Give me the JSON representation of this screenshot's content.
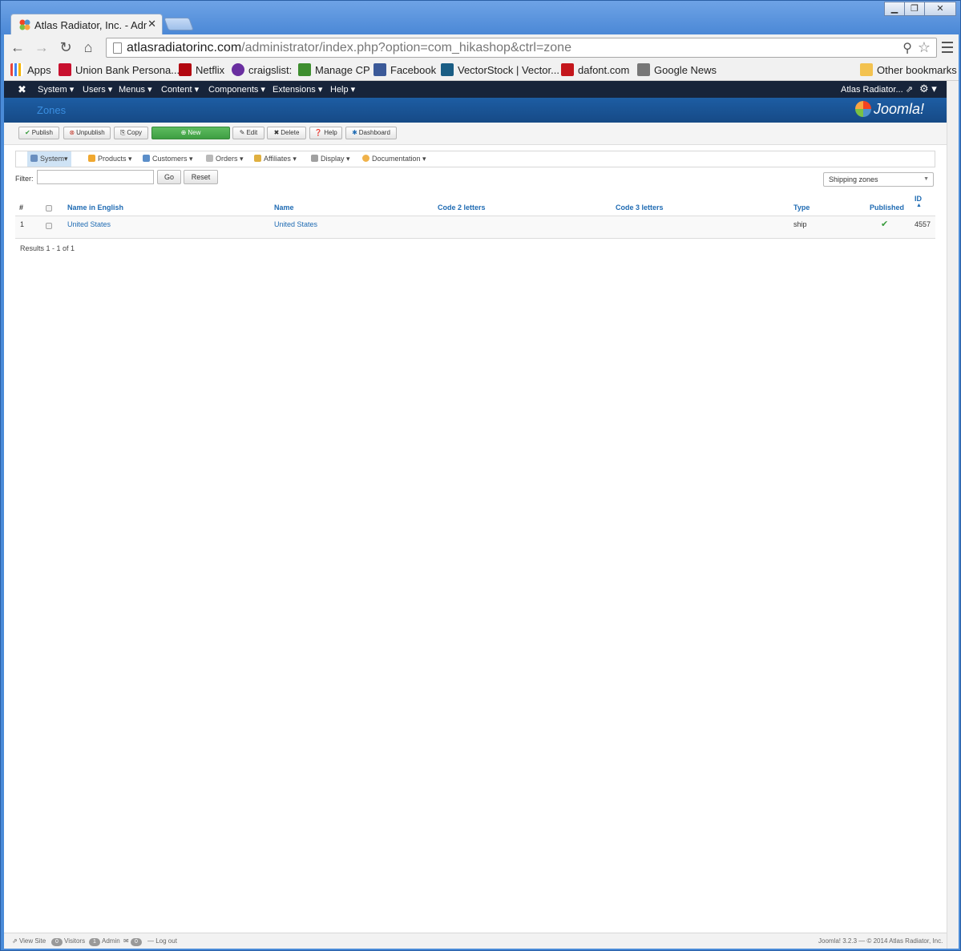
{
  "browser": {
    "tab_title": "Atlas Radiator, Inc. - Admi",
    "url_host": "atlasradiatorinc.com",
    "url_path": "/administrator/index.php?option=com_hikashop&ctrl=zone",
    "bookmarks": [
      {
        "label": "Apps",
        "color": "#e8453c"
      },
      {
        "label": "Union Bank Persona...",
        "color": "#c8102e"
      },
      {
        "label": "Netflix",
        "color": "#b20710"
      },
      {
        "label": "craigslist:",
        "color": "#6a2fa0"
      },
      {
        "label": "Manage CP",
        "color": "#3e8e2f"
      },
      {
        "label": "Facebook",
        "color": "#3b5998"
      },
      {
        "label": "VectorStock | Vector...",
        "color": "#1a5d84"
      },
      {
        "label": "dafont.com",
        "color": "#c4161c"
      },
      {
        "label": "Google News",
        "color": "#777777"
      }
    ],
    "other_bookmarks": "Other bookmarks"
  },
  "admin": {
    "menus": [
      "System",
      "Users",
      "Menus",
      "Content",
      "Components",
      "Extensions",
      "Help"
    ],
    "user": "Atlas Radiator...",
    "page_title": "Zones",
    "brand": "Joomla!"
  },
  "toolbar": {
    "publish": "Publish",
    "unpublish": "Unpublish",
    "copy": "Copy",
    "new": "New",
    "edit": "Edit",
    "delete": "Delete",
    "help": "Help",
    "dashboard": "Dashboard"
  },
  "hikashop_menu": [
    "System",
    "Products",
    "Customers",
    "Orders",
    "Affiliates",
    "Display",
    "Documentation"
  ],
  "filter": {
    "label": "Filter:",
    "value": "",
    "go": "Go",
    "reset": "Reset",
    "zone_type": "Shipping zones"
  },
  "table": {
    "headers": {
      "num": "#",
      "name_english": "Name in English",
      "name": "Name",
      "code2": "Code 2 letters",
      "code3": "Code 3 letters",
      "type": "Type",
      "published": "Published",
      "id": "ID"
    },
    "rows": [
      {
        "num": "1",
        "name_english": "United States",
        "name": "United States",
        "code2": "",
        "code3": "",
        "type": "ship",
        "published": true,
        "id": "4557"
      }
    ]
  },
  "results": "Results 1 - 1 of 1",
  "status_bar": {
    "view_site": "View Site",
    "visitors_count": "0",
    "visitors": "Visitors",
    "admin_count": "1",
    "admin": "Admin",
    "messages_count": "0",
    "log_out": "Log out",
    "copyright": "Joomla! 3.2.3 — © 2014 Atlas Radiator, Inc."
  },
  "colors": {
    "navbar": "#17243a",
    "header": "#1d5da3",
    "link": "#1f6bb3",
    "new_button": "#4caf50",
    "published_check": "#3a9c3e"
  }
}
